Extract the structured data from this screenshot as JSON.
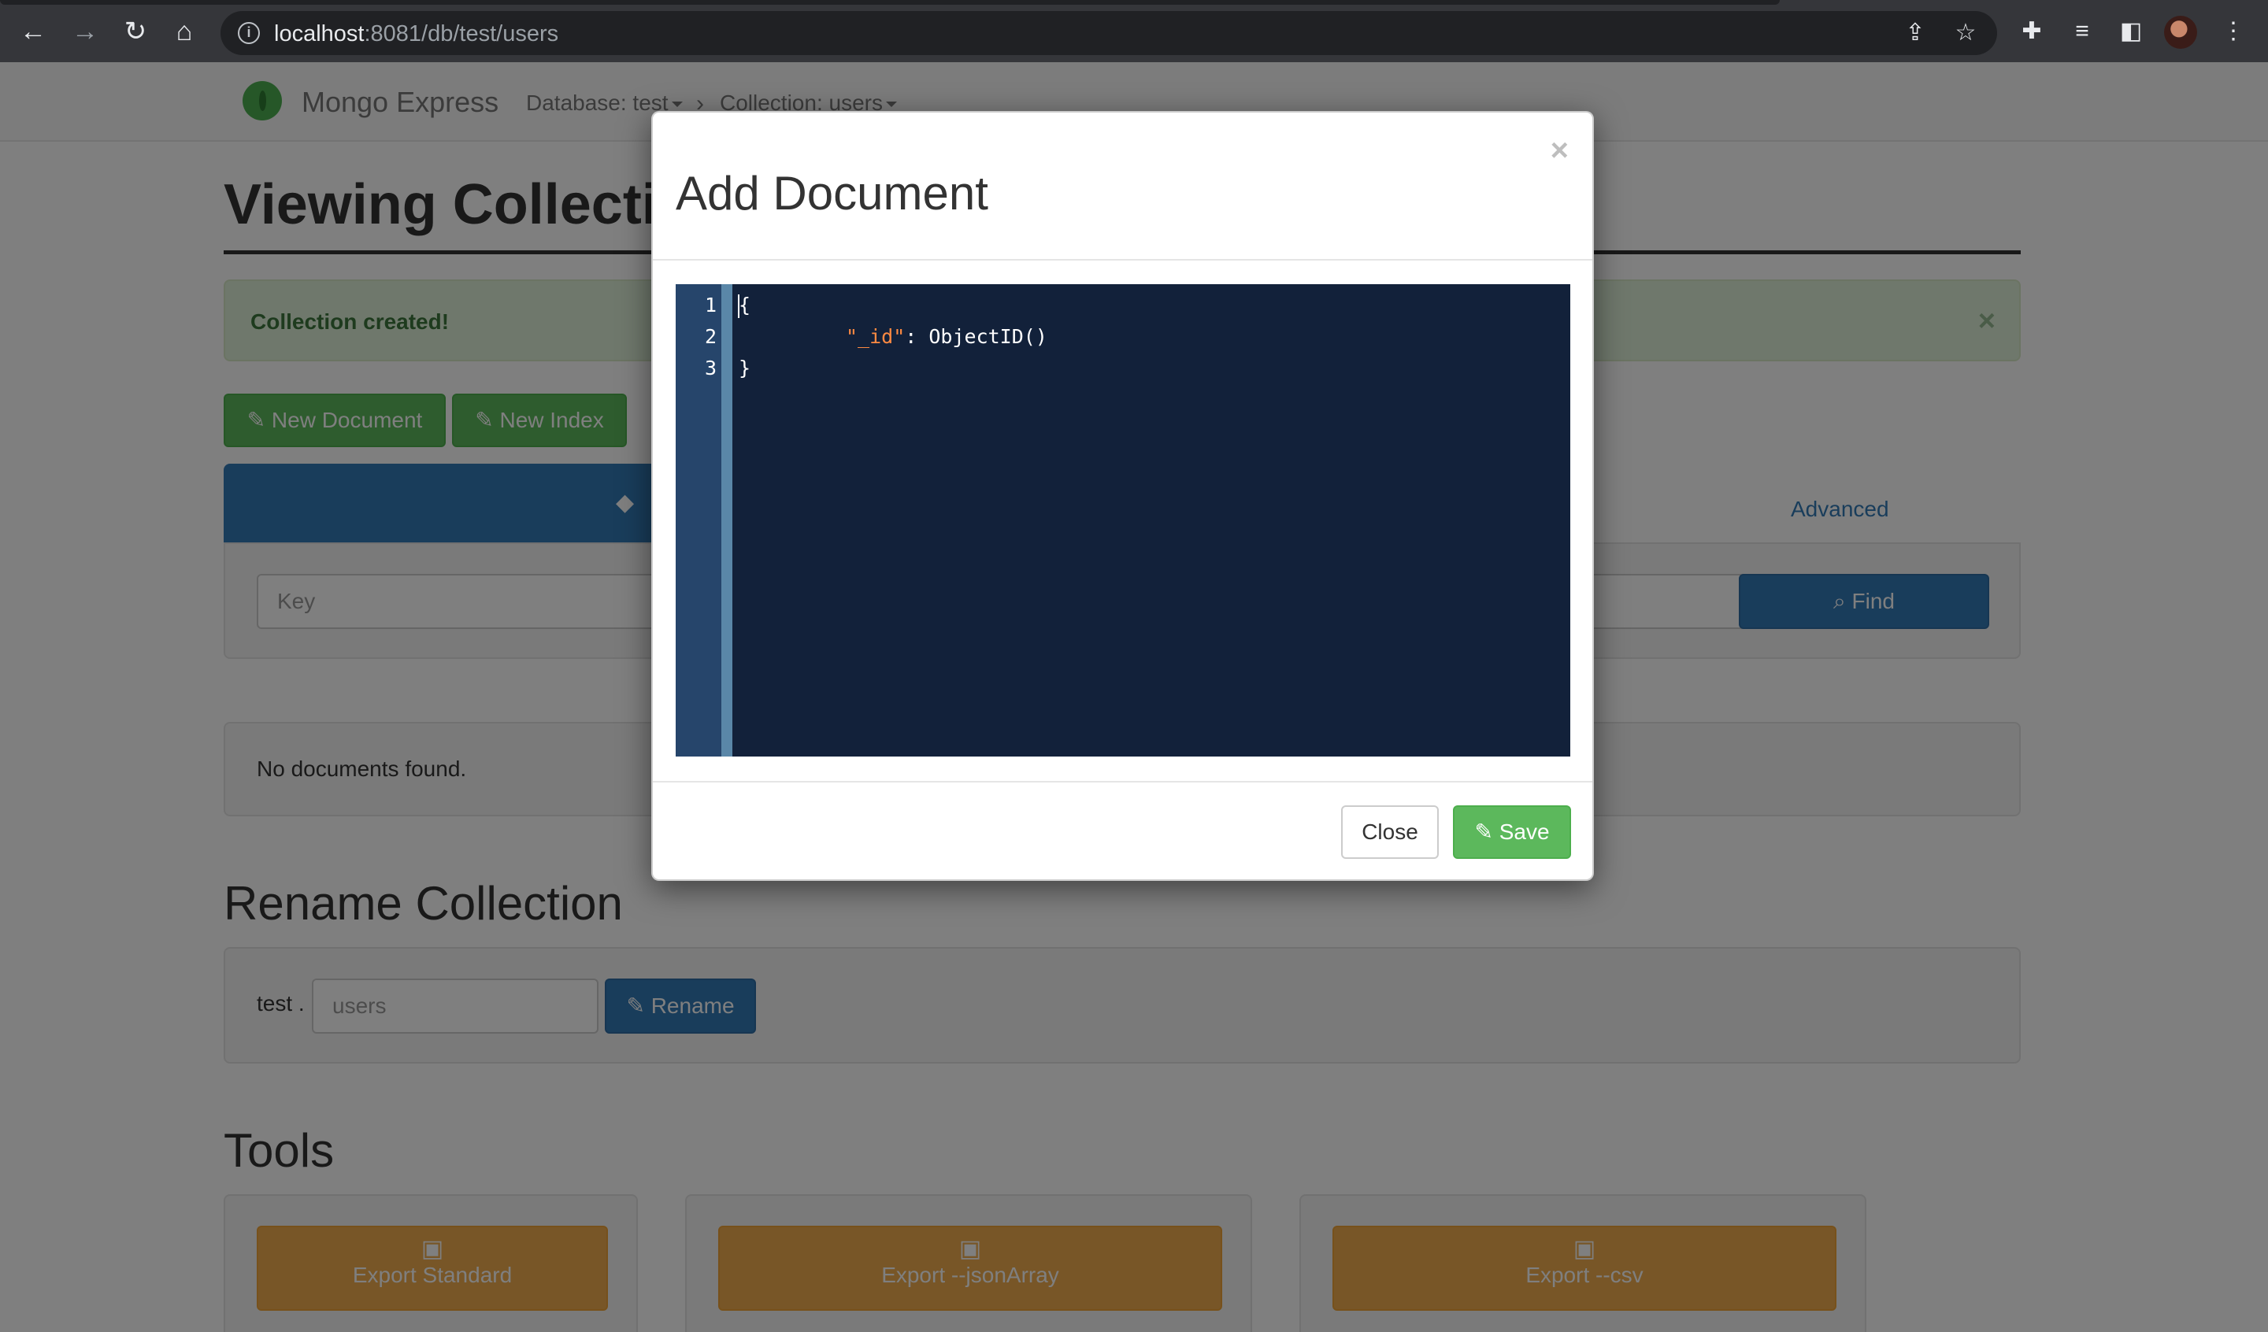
{
  "browser": {
    "url_host": "localhost",
    "url_rest": ":8081/db/test/users"
  },
  "navbar": {
    "brand": "Mongo Express",
    "database_crumb": "Database: test",
    "collection_crumb": "Collection: users"
  },
  "page": {
    "title": "Viewing Collection: users",
    "alert": "Collection created!",
    "new_document_label": "New Document",
    "new_index_label": "New Index",
    "advanced_link": "Advanced",
    "key_placeholder": "Key",
    "find_label": "Find",
    "no_documents": "No documents found.",
    "rename_heading": "Rename Collection",
    "rename_db_prefix": "test .",
    "rename_placeholder": "users",
    "rename_label": "Rename",
    "tools_heading": "Tools",
    "export_standard": "Export Standard",
    "export_jsonarray": "Export --jsonArray",
    "export_csv": "Export --csv"
  },
  "modal": {
    "title": "Add Document",
    "close_x": "×",
    "editor": {
      "line_numbers": [
        "1",
        "2",
        "3"
      ],
      "line1": "{",
      "line2_key": "\"_id\"",
      "line2_rest": ": ObjectID()",
      "line3": "}"
    },
    "close_label": "Close",
    "save_label": "Save"
  }
}
